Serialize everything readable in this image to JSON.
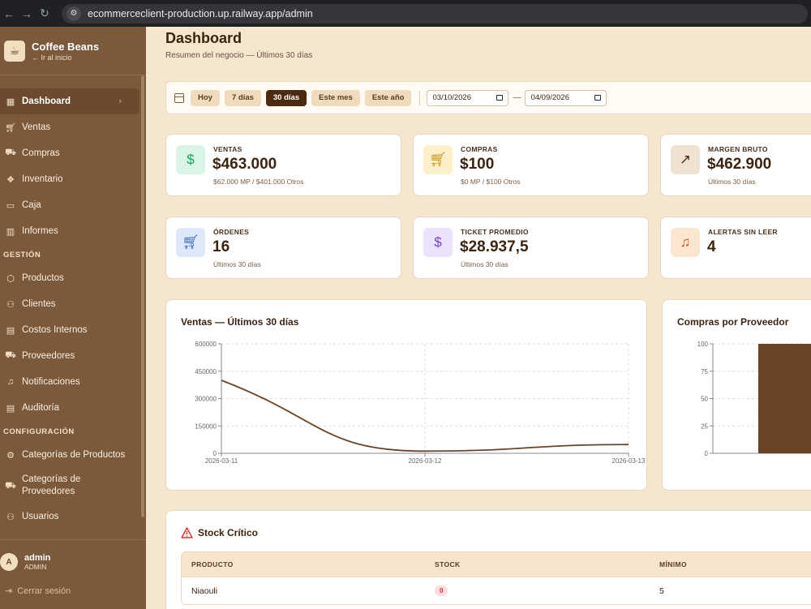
{
  "browser": {
    "url": "ecommerceclient-production.up.railway.app/admin"
  },
  "sidebar": {
    "brand": "Coffee Beans",
    "brand_sub": "← Ir al inicio",
    "items": [
      {
        "label": "Dashboard",
        "icon": "grid-icon"
      },
      {
        "label": "Ventas",
        "icon": "cart-icon"
      },
      {
        "label": "Compras",
        "icon": "truck-icon"
      },
      {
        "label": "Inventario",
        "icon": "boxes-icon"
      },
      {
        "label": "Caja",
        "icon": "cash-icon"
      },
      {
        "label": "Informes",
        "icon": "bar-chart-icon"
      }
    ],
    "gestion_title": "GESTIÓN",
    "gestion_items": [
      {
        "label": "Productos",
        "icon": "package-icon"
      },
      {
        "label": "Clientes",
        "icon": "users-icon"
      },
      {
        "label": "Costos Internos",
        "icon": "clipboard-icon"
      },
      {
        "label": "Proveedores",
        "icon": "truck-icon"
      },
      {
        "label": "Notificaciones",
        "icon": "bell-icon"
      },
      {
        "label": "Auditoría",
        "icon": "clipboard-icon"
      }
    ],
    "config_title": "CONFIGURACIÓN",
    "config_items": [
      {
        "label": "Categorías de Productos",
        "icon": "gear-icon"
      },
      {
        "label": "Categorías de Proveedores",
        "icon": "truck-icon"
      },
      {
        "label": "Usuarios",
        "icon": "users-icon"
      }
    ],
    "user": {
      "initial": "A",
      "name": "admin",
      "role": "ADMIN"
    },
    "logout": "Cerrar sesión"
  },
  "header": {
    "title": "Dashboard",
    "subtitle": "Resumen del negocio — Últimos 30 días"
  },
  "filters": {
    "ranges": [
      "Hoy",
      "7 días",
      "30 días",
      "Este mes",
      "Este año"
    ],
    "active": "30 días",
    "date_from": "03/10/2026",
    "date_to": "04/09/2026",
    "separator": "—"
  },
  "stats": [
    {
      "label": "VENTAS",
      "value": "$463.000",
      "note": "$62.000 MP / $401.000 Otros",
      "icon": "dollar-icon",
      "icon_bg": "#d9f5e6",
      "icon_color": "#1e9e5a"
    },
    {
      "label": "COMPRAS",
      "value": "$100",
      "note": "$0 MP / $100 Otros",
      "icon": "cart-icon",
      "icon_bg": "#fdf0c8",
      "icon_color": "#c28a12"
    },
    {
      "label": "MARGEN BRUTO",
      "value": "$462.900",
      "note": "Últimos 30 días",
      "icon": "trend-up-icon",
      "icon_bg": "#efe2d2",
      "icon_color": "#4b3018"
    },
    {
      "label": "ÓRDENES",
      "value": "16",
      "note": "Últimos 30 días",
      "icon": "cart-icon",
      "icon_bg": "#dde8fb",
      "icon_color": "#2c5fc0"
    },
    {
      "label": "TICKET PROMEDIO",
      "value": "$28.937,5",
      "note": "Últimos 30 días",
      "icon": "dollar-icon",
      "icon_bg": "#ebe2fb",
      "icon_color": "#7a3fd0"
    },
    {
      "label": "ALERTAS SIN LEER",
      "value": "4",
      "note": "",
      "icon": "bell-icon",
      "icon_bg": "#fde6cf",
      "icon_color": "#d9531e"
    }
  ],
  "chart_data": [
    {
      "type": "line",
      "title": "Ventas — Últimos 30 días",
      "x": [
        "2026-03-11",
        "2026-03-12",
        "2026-03-13"
      ],
      "values": [
        400000,
        12000,
        48000
      ],
      "yticks": [
        0,
        150000,
        300000,
        450000,
        600000
      ],
      "ylim": [
        0,
        600000
      ],
      "grid": true,
      "color": "#6b4427"
    },
    {
      "type": "bar",
      "title": "Compras por Proveedor",
      "values": [
        100
      ],
      "yticks": [
        0,
        25,
        50,
        75,
        100
      ],
      "ylim": [
        0,
        100
      ],
      "grid": true,
      "color": "#6b4427"
    }
  ],
  "stock": {
    "title": "Stock Crítico",
    "columns": [
      "PRODUCTO",
      "STOCK",
      "MÍNIMO"
    ],
    "rows": [
      {
        "producto": "Niaouli",
        "stock": "0",
        "minimo": "5"
      }
    ]
  }
}
